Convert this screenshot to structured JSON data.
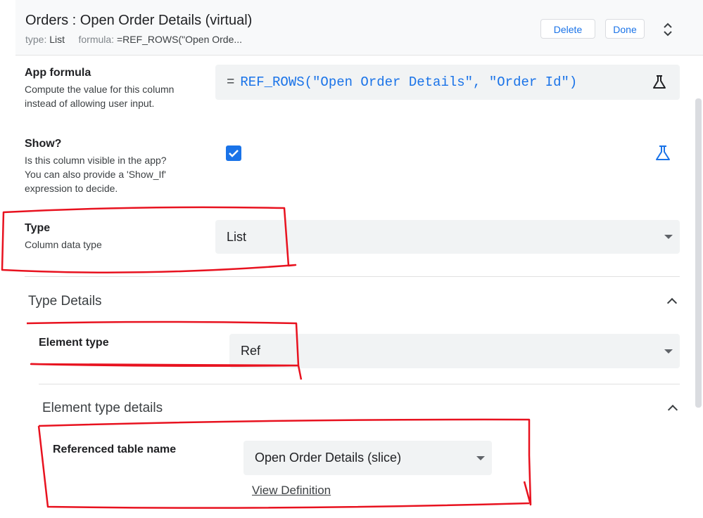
{
  "header": {
    "title": "Orders : Open Order Details (virtual)",
    "type_label": "type:",
    "type_value": "List",
    "formula_label": "formula:",
    "formula_value": "=REF_ROWS(\"Open Orde...",
    "delete_label": "Delete",
    "done_label": "Done",
    "expand_icon": "unfold-more-icon"
  },
  "app_formula": {
    "label": "App formula",
    "desc_line1": "Compute the value for this column",
    "desc_line2": "instead of allowing user input.",
    "eq": "=",
    "expression": "REF_ROWS(\"Open Order Details\", \"Order Id\")",
    "icon": "flask-icon"
  },
  "show": {
    "label": "Show?",
    "desc_line1": "Is this column visible in the app?",
    "desc_line2": "You can also provide a 'Show_If'",
    "desc_line3": "expression to decide.",
    "checked": true,
    "icon": "flask-icon",
    "icon_color": "#1a73e8"
  },
  "type": {
    "label": "Type",
    "desc": "Column data type",
    "value": "List"
  },
  "type_details": {
    "title": "Type Details",
    "element_type_label": "Element type",
    "element_type_value": "Ref"
  },
  "element_type_details": {
    "title": "Element type details",
    "ref_table_label": "Referenced table name",
    "ref_table_value": "Open Order Details (slice)",
    "view_definition": "View Definition"
  },
  "colors": {
    "accent": "#1a73e8",
    "annotation": "#e8121f"
  }
}
